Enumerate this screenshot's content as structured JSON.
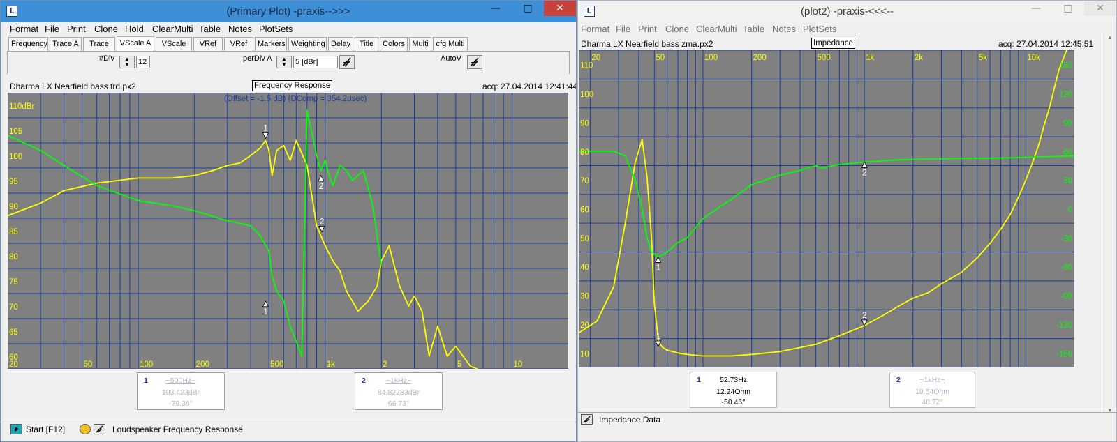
{
  "colors": {
    "trace_a": "#ffff00",
    "trace_b": "#00ff00",
    "grid": "#1a3e9e",
    "plot_bg": "#808080",
    "title_bar_active": "#3d8fd8"
  },
  "window1": {
    "title": "(Primary Plot) -praxis-->>>",
    "controls_min": "—",
    "controls_max": "□",
    "controls_close": "✕",
    "menu": [
      "Format",
      "File",
      "Print",
      "Clone",
      "Hold",
      "ClearMulti",
      "Table",
      "Notes",
      "PlotSets"
    ],
    "tabs": [
      "Frequency",
      "Trace A",
      "Trace B",
      "VScale A",
      "VScale B",
      "VRef A",
      "VRef B",
      "Markers",
      "Weighting",
      "Delay",
      "Title",
      "Colors",
      "Multi",
      "cfg Multi"
    ],
    "active_tab": "VScale A",
    "div_label": "#Div",
    "div_value": "12",
    "perdiv_label": "perDiv A",
    "perdiv_value": "5 [dBr]",
    "autov_label": "AutoV",
    "file_name": "Dharma LX Nearfield bass frd.px2",
    "plot_title": "Frequency Response",
    "acq": "acq: 27.04.2014 12:41:44",
    "offset_note": "(Offset = -1.5 dB) (DComp = 354.2usec)",
    "y_ticks": [
      "110dBr",
      "105",
      "100",
      "95",
      "90",
      "85",
      "80",
      "75",
      "70",
      "65",
      "60"
    ],
    "x_ticks": [
      "20",
      "50",
      "100",
      "200",
      "500",
      "1k",
      "2",
      "5",
      "10"
    ],
    "cursor1": {
      "num": "1",
      "freq": "~500Hz~",
      "val": "103.423dBr",
      "phase": "-79.36°"
    },
    "cursor2": {
      "num": "2",
      "freq": "~1kHz~",
      "val": "84.82283dBr",
      "phase": "66.73°"
    },
    "status_start": "Start [F12]",
    "status_text": "Loudspeaker Frequency Response"
  },
  "window2": {
    "title": "(plot2) -praxis-<<<--",
    "controls_min": "—",
    "controls_max": "□",
    "controls_close": "✕",
    "menu": [
      "Format",
      "File",
      "Print",
      "Clone",
      "ClearMulti",
      "Table",
      "Notes",
      "PlotSets"
    ],
    "file_name": "Dharma LX Nearfield bass zma.px2",
    "plot_title": "Impedance",
    "acq": "acq: 27.04.2014 12:45:51",
    "y_ticks": [
      "110",
      "100",
      "90",
      "80",
      "70",
      "60",
      "50",
      "40",
      "30",
      "20",
      "10"
    ],
    "y2_ticks": [
      "150",
      "120",
      "90",
      "60",
      "30",
      "0",
      "-30",
      "-60",
      "-90",
      "-120",
      "-150"
    ],
    "x_ticks": [
      "20",
      "50",
      "100",
      "200",
      "500",
      "1k",
      "2k",
      "5k",
      "10k"
    ],
    "cursor1": {
      "num": "1",
      "freq": "52.73Hz",
      "val": "12.24Ohm",
      "phase": "-50.46°"
    },
    "cursor2": {
      "num": "2",
      "freq": "~1kHz~",
      "val": "19.54Ohm",
      "phase": "48.72°"
    },
    "status_text": "Impedance Data"
  },
  "chart_data": [
    {
      "type": "line",
      "title": "Frequency Response",
      "xscale": "log",
      "xlim": [
        20,
        20000
      ],
      "ylim": [
        57.5,
        112.5
      ],
      "ylabel": "dBr",
      "series": [
        {
          "color": "#ffff00",
          "x": [
            20,
            30,
            40,
            60,
            100,
            150,
            200,
            250,
            300,
            350,
            400,
            450,
            480,
            500,
            520,
            550,
            600,
            650,
            700,
            800,
            900,
            1000,
            1100,
            1200,
            1300,
            1500,
            1700,
            1900,
            2000,
            2200,
            2500,
            2800,
            3000,
            3300,
            3600,
            4000,
            4500,
            5000,
            6000,
            7000,
            8000
          ],
          "values": [
            88,
            90.5,
            93,
            94.5,
            95.5,
            95.5,
            96,
            97,
            98,
            98.5,
            100,
            101.5,
            103,
            101,
            96,
            101,
            102,
            99,
            103,
            98,
            86,
            82,
            79,
            77,
            73,
            69,
            71,
            74,
            79,
            82,
            74,
            70,
            72,
            69,
            60,
            66,
            60,
            62,
            58,
            57,
            56
          ]
        },
        {
          "color": "#00ff00",
          "x": [
            20,
            30,
            40,
            60,
            100,
            150,
            200,
            300,
            400,
            450,
            500,
            520,
            550,
            600,
            650,
            700,
            750,
            800,
            900,
            950,
            1000,
            1050,
            1100,
            1200,
            1300,
            1400,
            1600,
            1800,
            2000
          ],
          "values": [
            104,
            101,
            98,
            94,
            91,
            90,
            89,
            87,
            86,
            84,
            81,
            76,
            73,
            71,
            66,
            63,
            60,
            109,
            100,
            97,
            99,
            96,
            94,
            98,
            97,
            95,
            97,
            90,
            78
          ]
        }
      ]
    },
    {
      "type": "line",
      "title": "Impedance",
      "xscale": "log",
      "xlim": [
        17,
        20000
      ],
      "ylim": [
        5,
        115
      ],
      "ylabel": "Ohm",
      "y2lim": [
        -165,
        165
      ],
      "series": [
        {
          "color": "#ffff00",
          "x": [
            17,
            22,
            28,
            33,
            38,
            42,
            45,
            48,
            50,
            53,
            56,
            60,
            70,
            80,
            100,
            150,
            200,
            300,
            500,
            700,
            1000,
            1300,
            1600,
            2000,
            2500,
            3000,
            4000,
            5000,
            6000,
            7000,
            8000,
            9000,
            10000,
            11000,
            12000,
            13000,
            14000,
            16000,
            20000
          ],
          "values": [
            17,
            21,
            33,
            55,
            76,
            84,
            71,
            50,
            27,
            14,
            12,
            11,
            10,
            9.5,
            9,
            9,
            9.5,
            10.5,
            13,
            16,
            19.5,
            23,
            26,
            29,
            31,
            34,
            38,
            43,
            48,
            53,
            58,
            64,
            70,
            76,
            82,
            89,
            95,
            108,
            122
          ]
        },
        {
          "color": "#00ff00",
          "x": [
            17,
            22,
            28,
            33,
            38,
            42,
            45,
            48,
            52.73,
            56,
            60,
            70,
            80,
            100,
            150,
            200,
            300,
            400,
            500,
            550,
            600,
            700,
            800,
            1000,
            1300,
            1600,
            2000,
            3000,
            5000,
            8000,
            12000,
            20000
          ],
          "phase": [
            60,
            60,
            60,
            55,
            30,
            0,
            -30,
            -45,
            -50,
            -48,
            -45,
            -35,
            -30,
            -10,
            10,
            25,
            35,
            40,
            45,
            42,
            44,
            46,
            47,
            48.7,
            50,
            51,
            51.5,
            52,
            52.5,
            53,
            54,
            55
          ]
        }
      ]
    }
  ]
}
